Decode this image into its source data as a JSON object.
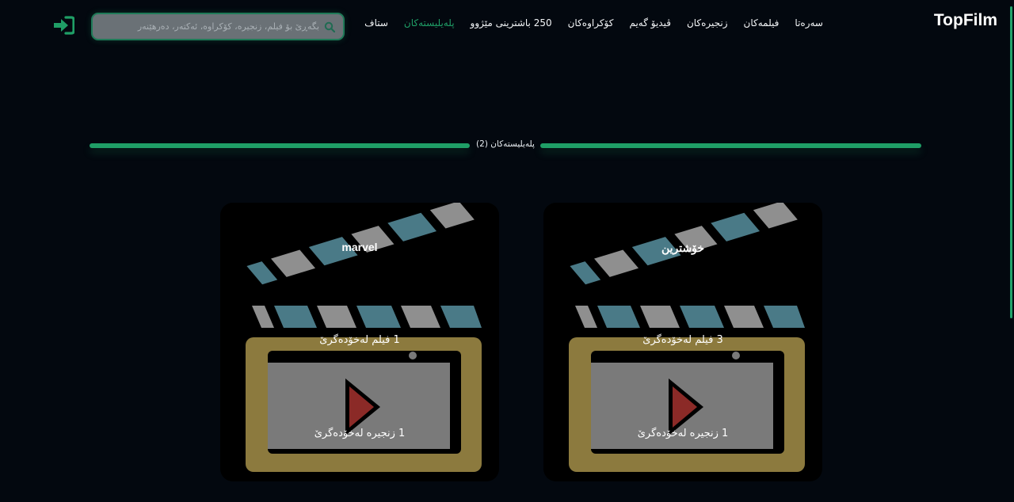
{
  "brand": "TopFilm",
  "nav": {
    "items": [
      {
        "label": "سەرەتا",
        "active": false
      },
      {
        "label": "فیلمەکان",
        "active": false
      },
      {
        "label": "زنجیرەکان",
        "active": false
      },
      {
        "label": "ڤیدیۆ گەیم",
        "active": false
      },
      {
        "label": "کۆکراوەکان",
        "active": false
      },
      {
        "label": "250 باشترینی مێژوو",
        "active": false
      },
      {
        "label": "پلەیلیستەکان",
        "active": true
      },
      {
        "label": "ستاف",
        "active": false
      }
    ]
  },
  "search": {
    "placeholder": "بگەڕێ بۆ فیلم، زنجیرە، کۆکراوە، ئەکتەر، دەرهێنەر",
    "icon": "search-icon"
  },
  "login": {
    "icon": "login-icon",
    "color": "#1f9e66"
  },
  "section": {
    "heading": "پلەیلیستەکان (2)"
  },
  "playlists": [
    {
      "title": "marvel",
      "films_line": "1 فیلم لەخۆدەگرێ",
      "series_line": "1 زنجیرە لەخۆدەگرێ",
      "icon": "clapperboard-icon"
    },
    {
      "title": "خۆشترین",
      "films_line": "3 فیلم لەخۆدەگرێ",
      "series_line": "1 زنجیرە لەخۆدەگرێ",
      "icon": "clapperboard-icon"
    }
  ],
  "colors": {
    "background": "#03080f",
    "accent": "#1f9e66",
    "clapper_stripe": "#4a7a87",
    "clapper_frame": "#8c7a3e",
    "play": "#8b2a27"
  }
}
